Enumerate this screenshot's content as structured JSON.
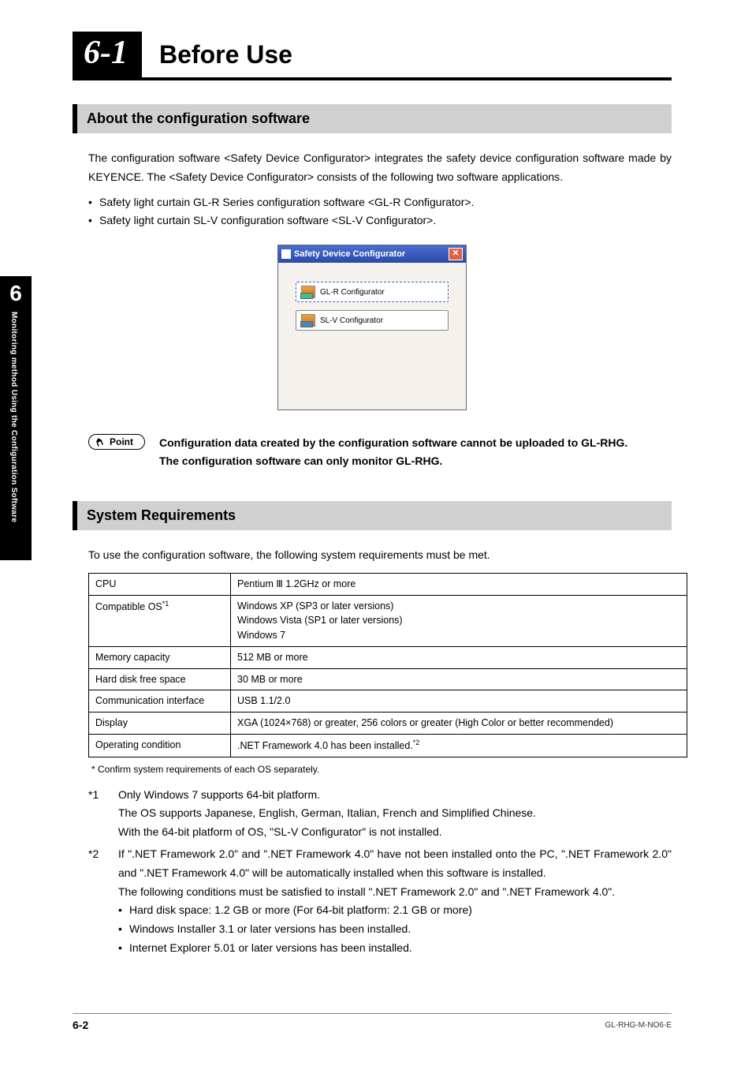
{
  "sidebar": {
    "chapter": "6",
    "label": "Monitoring method Using the Configuration Software"
  },
  "header": {
    "number": "6-1",
    "title": "Before Use"
  },
  "section1": {
    "title": "About the configuration software",
    "para": "The configuration software <Safety Device Configurator> integrates the safety device configuration software made by KEYENCE. The <Safety Device Configurator> consists of the following two software applications.",
    "bullets": [
      "Safety light curtain GL-R Series configuration software <GL-R Configurator>.",
      "Safety light curtain SL-V configuration software <SL-V Configurator>."
    ],
    "screenshot": {
      "title": "Safety Device Configurator",
      "btn1": "GL-R Configurator",
      "btn2": "SL-V Configurator",
      "close": "✕"
    },
    "pointLabel": "Point",
    "pointText1": "Configuration data created by the configuration software cannot be uploaded to GL-RHG.",
    "pointText2": "The configuration software can only monitor GL-RHG."
  },
  "section2": {
    "title": "System Requirements",
    "intro": "To use the configuration software, the following system requirements must be met.",
    "rows": [
      {
        "k": "CPU",
        "v": "Pentium Ⅲ 1.2GHz or more"
      },
      {
        "k": "Compatible OS",
        "sup": "*1",
        "v": "Windows XP (SP3 or later versions)\nWindows Vista (SP1 or later versions)\nWindows 7"
      },
      {
        "k": "Memory capacity",
        "v": "512 MB or more"
      },
      {
        "k": "Hard disk free space",
        "v": "30 MB or more"
      },
      {
        "k": "Communication interface",
        "v": "USB 1.1/2.0"
      },
      {
        "k": "Display",
        "v": "XGA (1024×768) or greater, 256 colors or greater (High Color or better recommended)"
      },
      {
        "k": "Operating condition",
        "v": ".NET Framework 4.0 has been installed.",
        "vsup": "*2"
      }
    ],
    "star": "*   Confirm system requirements of each OS separately.",
    "n1label": "*1",
    "n1a": "Only Windows 7 supports 64-bit platform.",
    "n1b": "The OS supports Japanese, English, German, Italian, French and Simplified Chinese.",
    "n1c": "With the 64-bit platform of OS, \"SL-V Configurator\" is not installed.",
    "n2label": "*2",
    "n2a": "If \".NET Framework 2.0\" and \".NET Framework 4.0\" have not been installed onto the PC, \".NET Framework 2.0\" and \".NET Framework 4.0\" will be automatically installed when this software is installed.",
    "n2b": "The following conditions must be satisfied to install \".NET Framework 2.0\" and \".NET Framework 4.0\".",
    "n2bullets": [
      "Hard disk space: 1.2 GB or more (For 64-bit platform: 2.1 GB or more)",
      "Windows Installer 3.1 or later versions has been installed.",
      "Internet Explorer 5.01 or later versions has been installed."
    ]
  },
  "footer": {
    "page": "6-2",
    "doc": "GL-RHG-M-NO6-E"
  }
}
